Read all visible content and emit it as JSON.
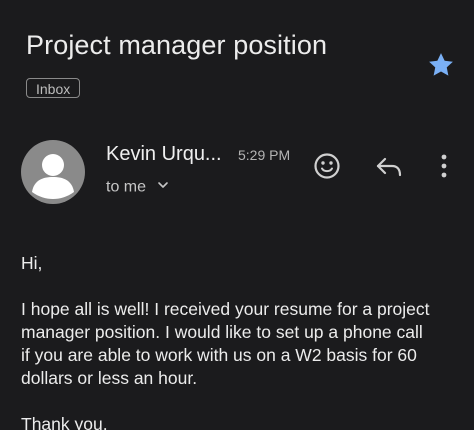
{
  "email": {
    "subject": "Project manager position",
    "label": "Inbox",
    "starred": true,
    "sender": "Kevin Urqu...",
    "time": "5:29 PM",
    "recipient": "to me",
    "greeting": "Hi,",
    "body_lines": [
      "I hope all is well! I received your resume for a project",
      "manager position. I would like to set up a phone call",
      "if you are able to work with us on a W2 basis for 60",
      "dollars or less an hour."
    ],
    "closing": "Thank you,"
  },
  "icons": {
    "star": "star-icon",
    "avatar": "person-icon",
    "chevron": "chevron-down-icon",
    "emoji": "emoji-react-icon",
    "reply": "reply-icon",
    "more": "more-vert-icon"
  },
  "colors": {
    "background": "#1b1b1d",
    "star": "#7ab0f5",
    "avatar": "#8a8a8a",
    "text": "#ececec"
  }
}
